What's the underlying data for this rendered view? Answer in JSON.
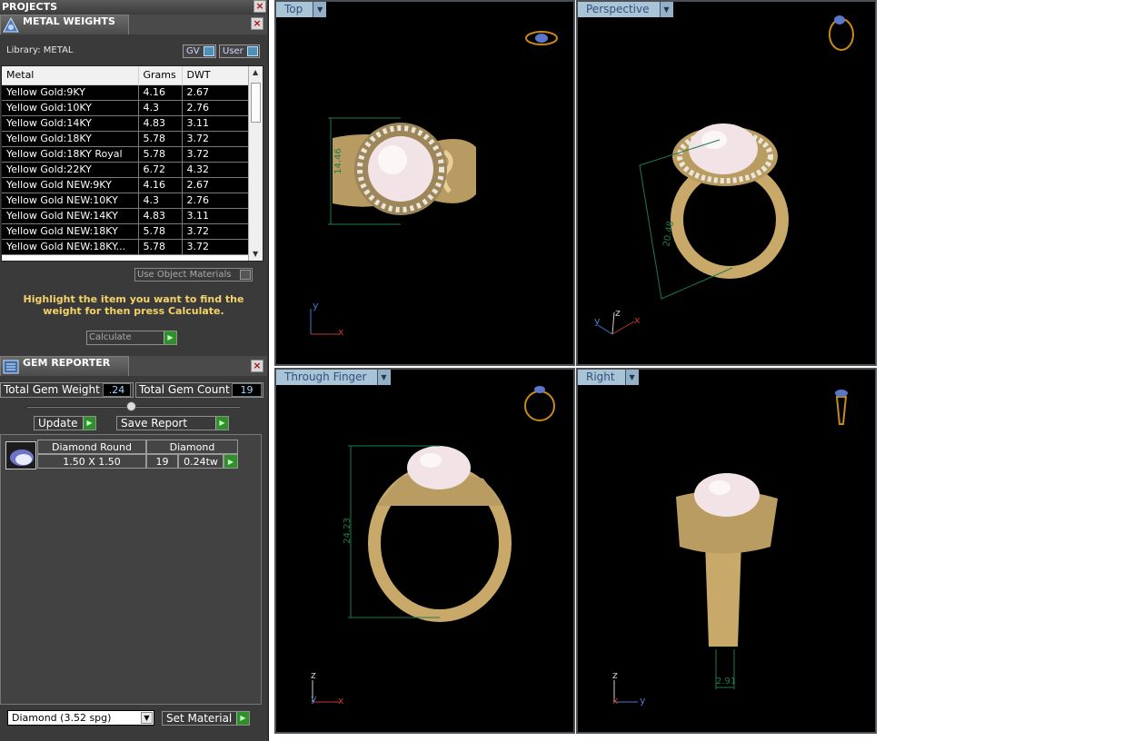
{
  "projects_title": "PROJECTS",
  "metal_panel": {
    "title": "METAL WEIGHTS",
    "library_label": "Library: METAL",
    "toggle_gv": "GV",
    "toggle_user": "User",
    "columns": [
      "Metal",
      "Grams",
      "DWT"
    ],
    "rows": [
      [
        "Yellow Gold:9KY",
        "4.16",
        "2.67"
      ],
      [
        "Yellow Gold:10KY",
        "4.3",
        "2.76"
      ],
      [
        "Yellow Gold:14KY",
        "4.83",
        "3.11"
      ],
      [
        "Yellow Gold:18KY",
        "5.78",
        "3.72"
      ],
      [
        "Yellow Gold:18KY Royal",
        "5.78",
        "3.72"
      ],
      [
        "Yellow Gold:22KY",
        "6.72",
        "4.32"
      ],
      [
        "Yellow Gold NEW:9KY",
        "4.16",
        "2.67"
      ],
      [
        "Yellow Gold NEW:10KY",
        "4.3",
        "2.76"
      ],
      [
        "Yellow Gold NEW:14KY",
        "4.83",
        "3.11"
      ],
      [
        "Yellow Gold NEW:18KY",
        "5.78",
        "3.72"
      ],
      [
        "Yellow Gold NEW:18KY...",
        "5.78",
        "3.72"
      ]
    ],
    "use_object_materials": "Use Object Materials",
    "hint": "Highlight the item you want to find the weight for then press Calculate.",
    "calculate_label": "Calculate"
  },
  "gem_panel": {
    "title": "GEM REPORTER",
    "total_weight_label": "Total Gem Weight",
    "total_weight_value": ".24",
    "total_count_label": "Total Gem Count",
    "total_count_value": "19",
    "update_label": "Update",
    "save_report_label": "Save Report",
    "gem_shape": "Diamond Round",
    "gem_type": "Diamond",
    "gem_size": "1.50 X 1.50",
    "gem_count": "19",
    "gem_weight": "0.24tw",
    "material_select": "Diamond    (3.52 spg)",
    "set_material_label": "Set Material"
  },
  "viewports": {
    "top": {
      "label": "Top",
      "dimension": "14.46"
    },
    "perspective": {
      "label": "Perspective",
      "dimension": "20.48"
    },
    "through_finger": {
      "label": "Through Finger",
      "dimension": "24.23"
    },
    "right": {
      "label": "Right",
      "dimension": "2.91"
    }
  },
  "axes": {
    "x": "x",
    "y": "y",
    "z": "z"
  },
  "colors": {
    "gold": "#c9a96a",
    "pearl": "#f2e4e6",
    "dim": "#1f7a4a",
    "axis_red": "#c0392b",
    "axis_blue": "#4a7ac7"
  }
}
